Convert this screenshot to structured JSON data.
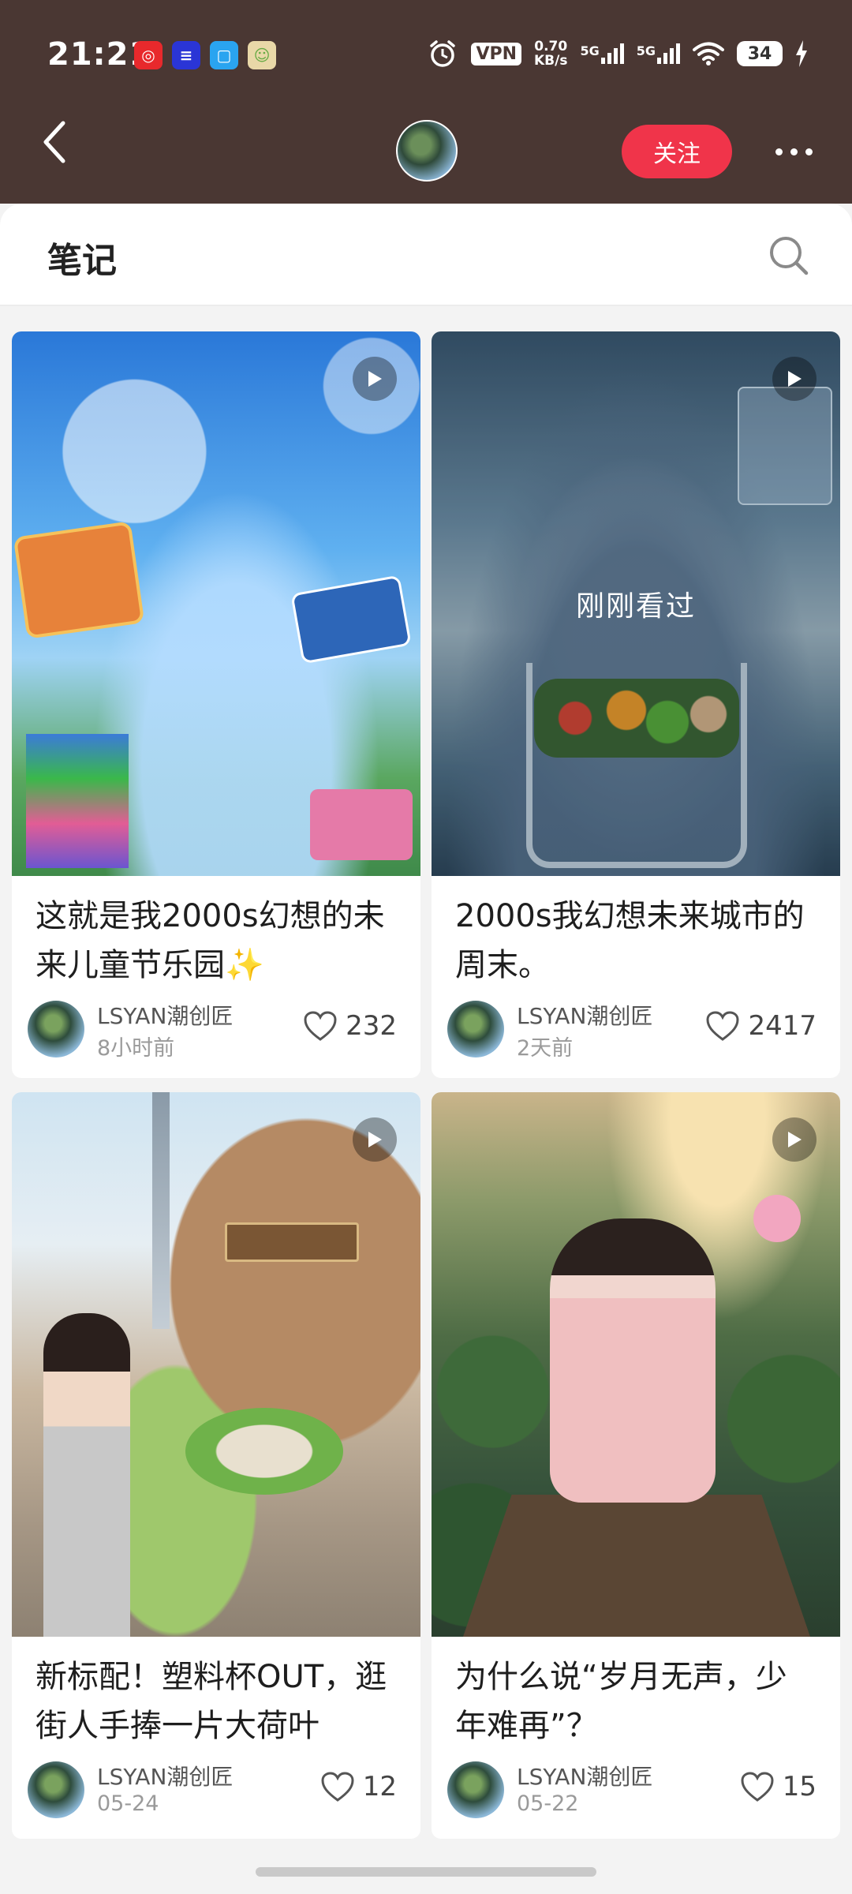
{
  "status_bar": {
    "time": "21:21",
    "vpn": "VPN",
    "net_speed_value": "0.70",
    "net_speed_unit": "KB/s",
    "network_1": "5G",
    "network_2": "5G",
    "battery": "34"
  },
  "nav": {
    "follow_label": "关注"
  },
  "section": {
    "title": "笔记"
  },
  "colors": {
    "header_bg": "#4a3733",
    "follow_bg": "#f0344a"
  },
  "notes": [
    {
      "title": "这就是我2000s幻想的未来儿童节乐园✨",
      "author": "LSYAN潮创匠",
      "time": "8小时前",
      "likes": "232",
      "is_video": true
    },
    {
      "title": "2000s我幻想未来城市的周末。",
      "author": "LSYAN潮创匠",
      "time": "2天前",
      "likes": "2417",
      "is_video": true,
      "overlay_label": "刚刚看过"
    },
    {
      "title": "新标配！塑料杯OUT，逛街人手捧一片大荷叶",
      "author": "LSYAN潮创匠",
      "time": "05-24",
      "likes": "12",
      "is_video": true
    },
    {
      "title": "为什么说“岁月无声，少年难再”？",
      "author": "LSYAN潮创匠",
      "time": "05-22",
      "likes": "15",
      "is_video": true
    }
  ],
  "icons": [
    "back-arrow-icon",
    "search-icon",
    "more-icon",
    "play-icon",
    "heart-icon",
    "wifi-icon",
    "alarm-icon",
    "charging-icon"
  ]
}
